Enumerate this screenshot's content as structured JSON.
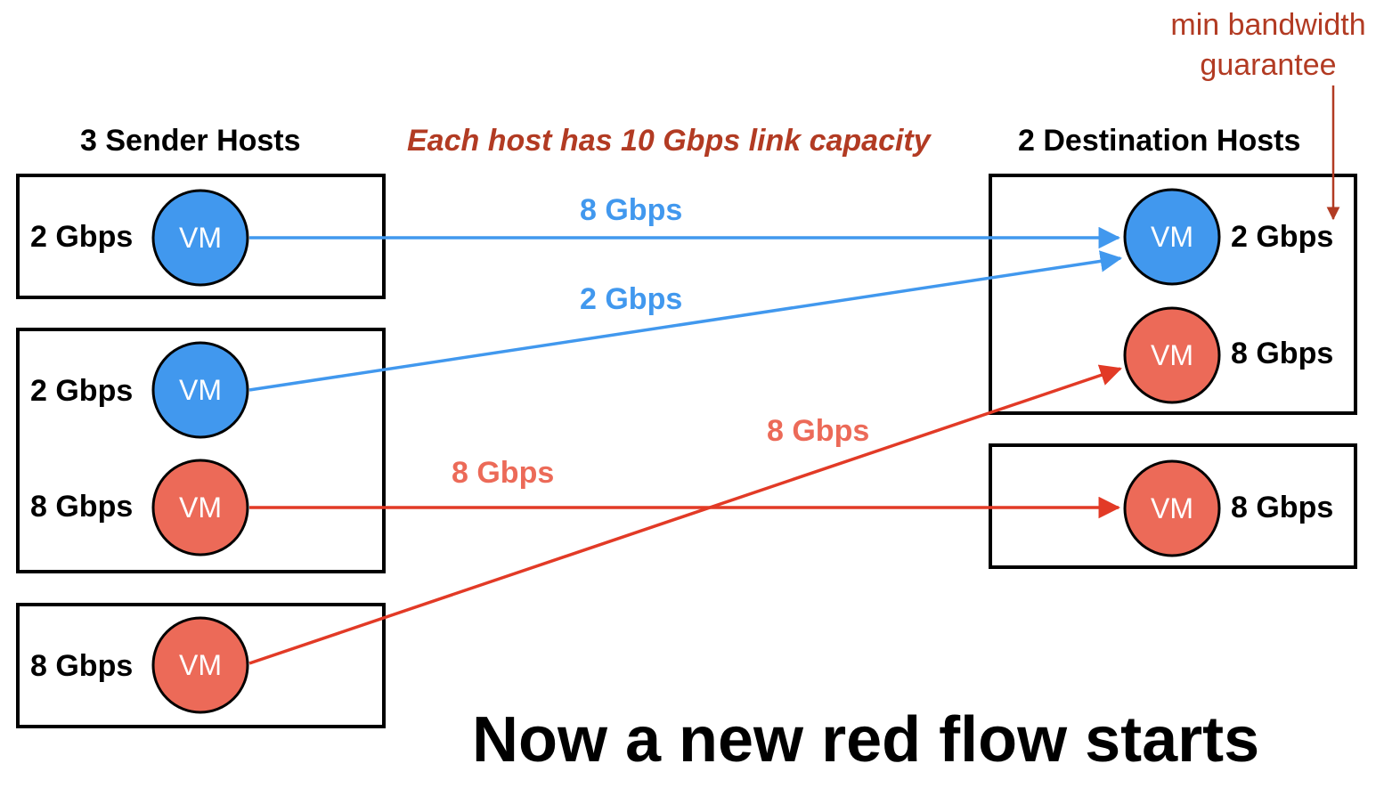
{
  "colors": {
    "blue": "#4198EE",
    "red": "#EC6A58",
    "flow_red_line": "#E23A26",
    "annotation_red": "#B23B23",
    "border": "#000000"
  },
  "headers": {
    "senders": "3 Sender Hosts",
    "destinations": "2 Destination Hosts",
    "capacity_note": "Each host has 10 Gbps link capacity"
  },
  "annotation": {
    "line1": "min bandwidth",
    "line2": "guarantee"
  },
  "vm_label": "VM",
  "senders": [
    {
      "vms": [
        {
          "color": "blue",
          "guarantee": "2 Gbps"
        }
      ]
    },
    {
      "vms": [
        {
          "color": "blue",
          "guarantee": "2 Gbps"
        },
        {
          "color": "red",
          "guarantee": "8 Gbps"
        }
      ]
    },
    {
      "vms": [
        {
          "color": "red",
          "guarantee": "8 Gbps"
        }
      ]
    }
  ],
  "destinations": [
    {
      "vms": [
        {
          "color": "blue",
          "guarantee": "2 Gbps"
        },
        {
          "color": "red",
          "guarantee": "8 Gbps"
        }
      ]
    },
    {
      "vms": [
        {
          "color": "red",
          "guarantee": "8 Gbps"
        }
      ]
    }
  ],
  "flows": [
    {
      "from": "sender-1-vm-1",
      "to": "dest-1-vm-1",
      "color": "blue",
      "rate": "8 Gbps"
    },
    {
      "from": "sender-2-vm-1",
      "to": "dest-1-vm-1",
      "color": "blue",
      "rate": "2 Gbps"
    },
    {
      "from": "sender-2-vm-2",
      "to": "dest-2-vm-1",
      "color": "red",
      "rate": "8 Gbps"
    },
    {
      "from": "sender-3-vm-1",
      "to": "dest-1-vm-2",
      "color": "red",
      "rate": "8 Gbps"
    }
  ],
  "caption": "Now a new red flow starts"
}
